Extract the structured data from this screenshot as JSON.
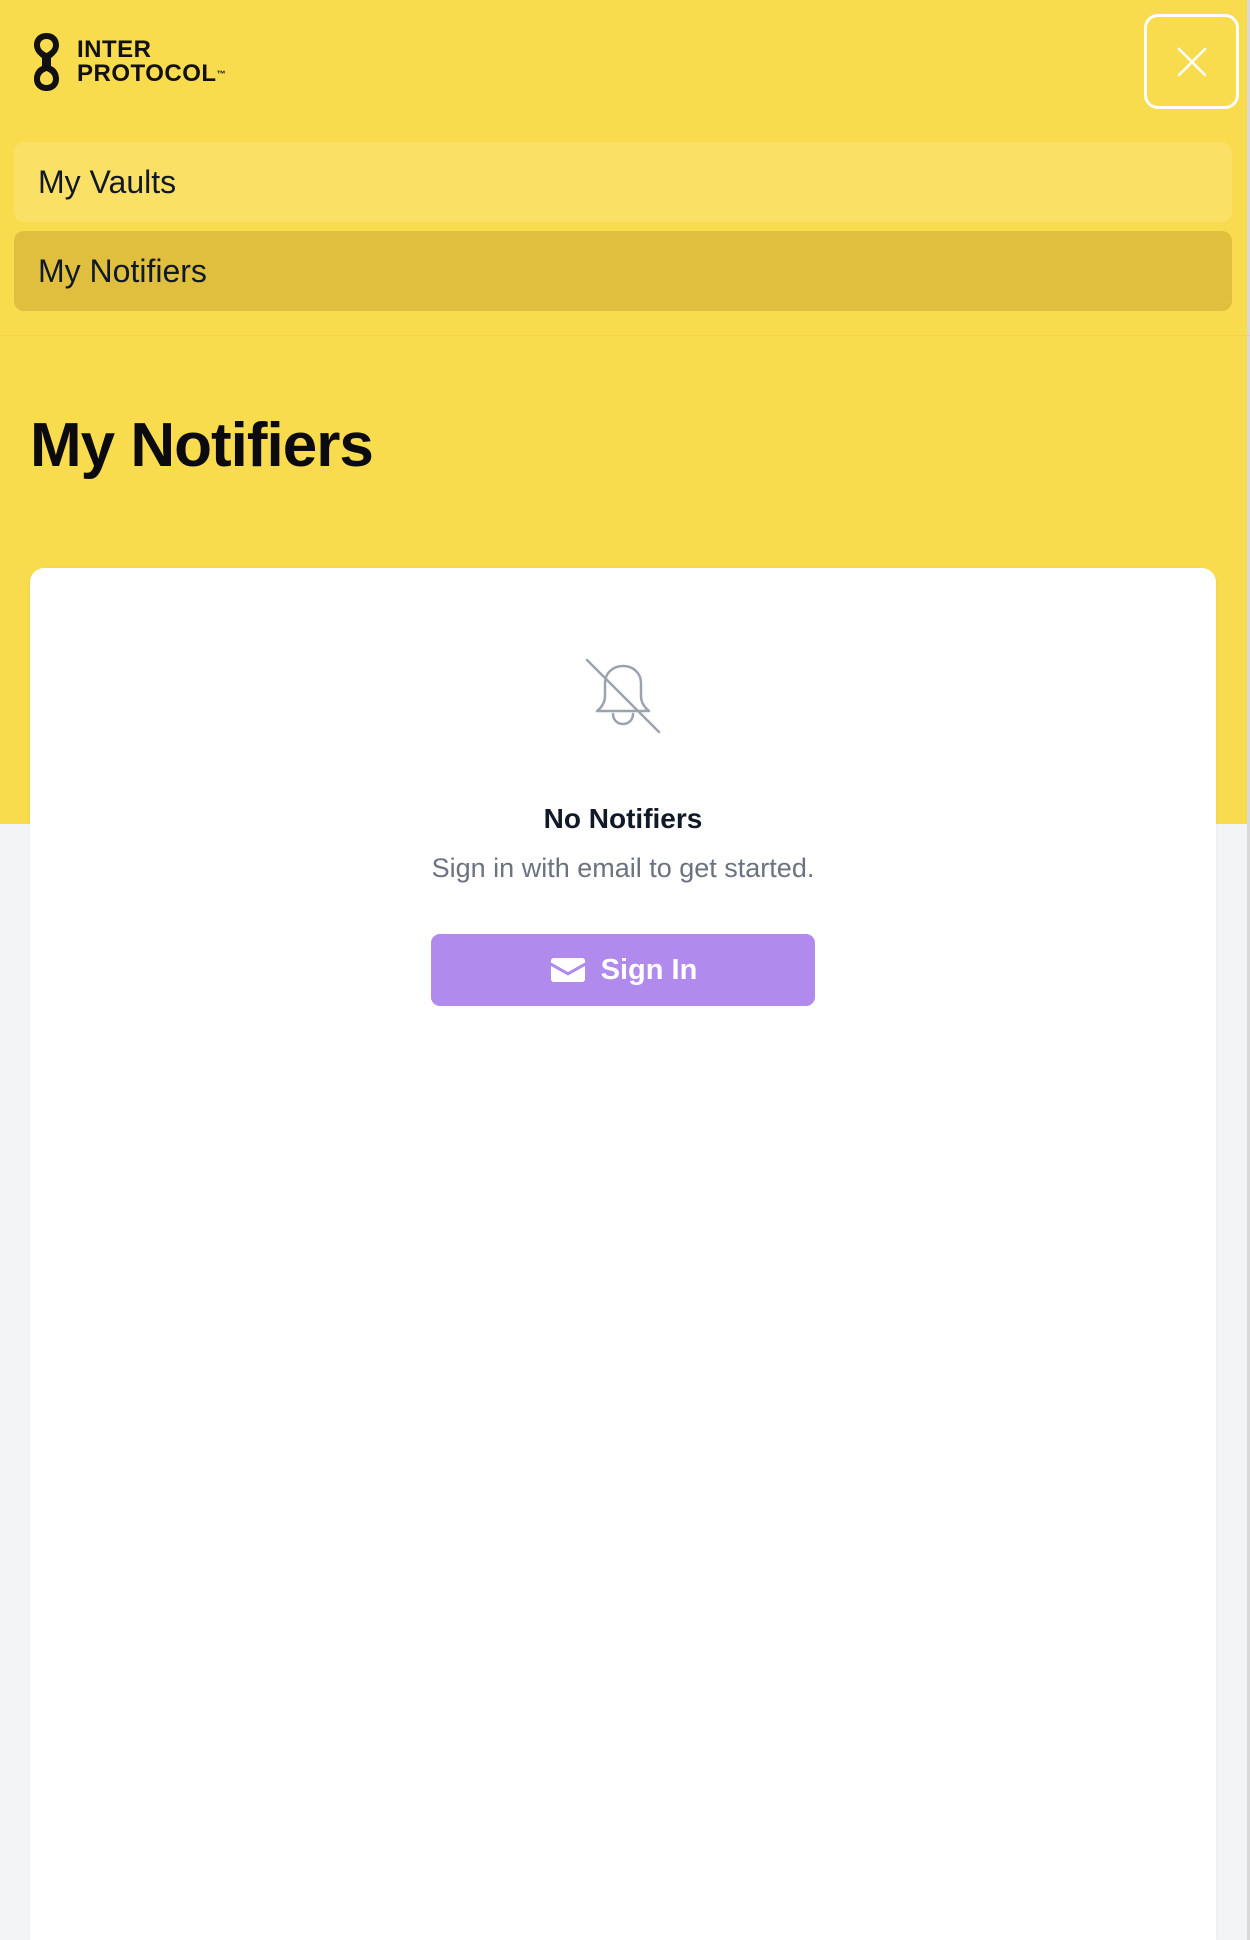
{
  "header": {
    "logo_line1": "INTER",
    "logo_line2": "PROTOCOL",
    "logo_tm": "™",
    "close_icon": "close-icon"
  },
  "nav": {
    "items": [
      {
        "label": "My Vaults",
        "active": false
      },
      {
        "label": "My Notifiers",
        "active": true
      }
    ]
  },
  "main": {
    "title": "My Notifiers",
    "empty_state": {
      "icon": "bell-off-icon",
      "title": "No Notifiers",
      "subtitle": "Sign in with email to get started.",
      "button_label": "Sign In",
      "button_icon": "envelope-icon"
    }
  },
  "colors": {
    "header_bg": "#f9db4e",
    "nav_item_bg": "#fae064",
    "nav_item_active_bg": "#e0bf3f",
    "button_bg": "#b18aee",
    "page_bg": "#f3f4f6"
  }
}
